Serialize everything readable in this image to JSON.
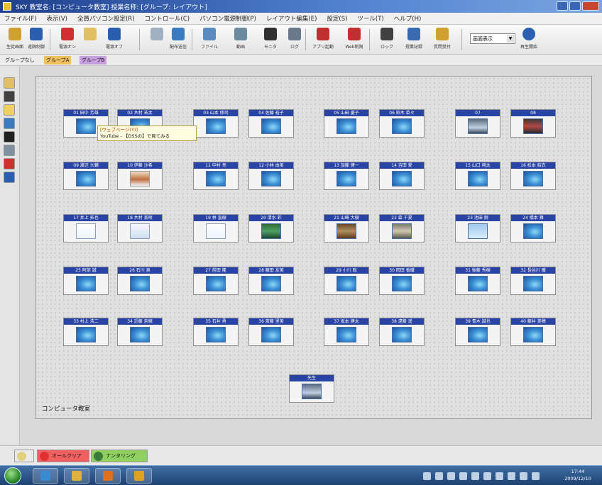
{
  "window": {
    "title": "SKY 教室名: [コンピュータ教室] 授業名称: [グループ: レイアウト]",
    "accent": "#2a44a6"
  },
  "menubar": [
    "ファイル(F)",
    "表示(V)",
    "全員パソコン設定(R)",
    "コントロール(C)",
    "パソコン電源制御(P)",
    "レイアウト編集(E)",
    "設定(S)",
    "ツール(T)",
    "ヘルプ(H)"
  ],
  "toolbar": {
    "buttons": [
      {
        "label": "生徒画面",
        "icon": "screen-share-icon",
        "color": "#d0a030"
      },
      {
        "label": "遠隔制御",
        "icon": "remote-icon",
        "color": "#2a5fb0"
      },
      {
        "label": "電源オン",
        "icon": "power-on-icon",
        "color": "#d03030"
      },
      {
        "label": "",
        "icon": "user-icon",
        "color": "#e0c060"
      },
      {
        "label": "電源オフ",
        "icon": "power-off-icon",
        "color": "#2a5fb0"
      },
      {
        "label": "",
        "icon": "message-icon",
        "color": "#a0b0c0"
      },
      {
        "label": "配布送信",
        "icon": "distribute-icon",
        "color": "#3a7ac0"
      },
      {
        "label": "ファイル",
        "icon": "file-icon",
        "color": "#5a8ac0"
      },
      {
        "label": "動画",
        "icon": "video-icon",
        "color": "#6a8aa0"
      },
      {
        "label": "モニタ",
        "icon": "monitor-icon",
        "color": "#303030"
      },
      {
        "label": "ログ",
        "icon": "log-icon",
        "color": "#6a7a8a"
      },
      {
        "label": "アプリ起動",
        "icon": "app-launch-icon",
        "color": "#c03030"
      },
      {
        "label": "Web制限",
        "icon": "web-block-icon",
        "color": "#c03030"
      },
      {
        "label": "ロック",
        "icon": "lock-icon",
        "color": "#404040"
      },
      {
        "label": "授業記録",
        "icon": "record-icon",
        "color": "#3a6ab0"
      },
      {
        "label": "質問受付",
        "icon": "question-icon",
        "color": "#d0a030"
      }
    ],
    "display_select": {
      "value": "画面表示",
      "arrow": "▼"
    },
    "play_button": {
      "label": "再生開始",
      "icon": "play-icon",
      "color": "#2a5fb0"
    }
  },
  "group_tabs": [
    {
      "label": "グループなし",
      "bg": "#ececec"
    },
    {
      "label": "グループA",
      "bg": "#f0c060"
    },
    {
      "label": "グループB",
      "bg": "#c8a0e0"
    }
  ],
  "left_dock": [
    {
      "icon": "student-icon",
      "color": "#e0c060"
    },
    {
      "icon": "grid-icon",
      "color": "#404040"
    },
    {
      "icon": "mail-icon",
      "color": "#f0d060"
    },
    {
      "icon": "share-icon",
      "color": "#3a7ac0"
    },
    {
      "icon": "monitor-black-icon",
      "color": "#202020"
    },
    {
      "icon": "layout-icon",
      "color": "#8090a0"
    },
    {
      "icon": "power-icon",
      "color": "#d03030"
    },
    {
      "icon": "power-blue-icon",
      "color": "#2a5fb0"
    }
  ],
  "classroom": {
    "label": "コンピュータ教室",
    "pcs": [
      {
        "name": "01 田中 芳雄",
        "screen": "win"
      },
      {
        "name": "02 木村 祐太",
        "screen": "win"
      },
      {
        "name": "03 山本 修司",
        "screen": "win"
      },
      {
        "name": "04 佐藤 裕子",
        "screen": "win"
      },
      {
        "name": "05 山田 慶子",
        "screen": "win"
      },
      {
        "name": "06 鈴木 菜々",
        "screen": "win"
      },
      {
        "name": "07",
        "screen": "tv"
      },
      {
        "name": "08",
        "screen": "red"
      },
      {
        "name": "09 渡辺 大輔",
        "screen": "win"
      },
      {
        "name": "10 伊藤 沙希",
        "screen": "video"
      },
      {
        "name": "11 中村 亮",
        "screen": "win"
      },
      {
        "name": "12 小林 由美",
        "screen": "win"
      },
      {
        "name": "13 加藤 健一",
        "screen": "win"
      },
      {
        "name": "14 吉田 愛",
        "screen": "win"
      },
      {
        "name": "15 山口 翔太",
        "screen": "win"
      },
      {
        "name": "16 松本 結衣",
        "screen": "win"
      },
      {
        "name": "17 井上 拓也",
        "screen": "doc"
      },
      {
        "name": "18 木村 美咲",
        "screen": "doc2"
      },
      {
        "name": "19 林 直樹",
        "screen": "doc"
      },
      {
        "name": "20 清水 彩",
        "screen": "green"
      },
      {
        "name": "21 山崎 大樹",
        "screen": "photo"
      },
      {
        "name": "22 森 千夏",
        "screen": "photo2"
      },
      {
        "name": "23 池田 剛",
        "screen": "blue2"
      },
      {
        "name": "24 橋本 舞",
        "screen": "win"
      },
      {
        "name": "25 阿部 誠",
        "screen": "win"
      },
      {
        "name": "26 石川 恵",
        "screen": "win"
      },
      {
        "name": "27 前田 隆",
        "screen": "win"
      },
      {
        "name": "28 藤田 友美",
        "screen": "win"
      },
      {
        "name": "29 小川 聡",
        "screen": "win"
      },
      {
        "name": "30 岡田 香織",
        "screen": "win"
      },
      {
        "name": "31 後藤 秀樹",
        "screen": "win"
      },
      {
        "name": "32 長谷川 瞳",
        "screen": "win"
      },
      {
        "name": "33 村上 浩二",
        "screen": "win"
      },
      {
        "name": "34 近藤 奈緒",
        "screen": "win"
      },
      {
        "name": "35 石井 勇",
        "screen": "win"
      },
      {
        "name": "36 斎藤 里美",
        "screen": "win"
      },
      {
        "name": "37 坂本 健太",
        "screen": "win"
      },
      {
        "name": "38 遠藤 遥",
        "screen": "win"
      },
      {
        "name": "39 青木 誠也",
        "screen": "win"
      },
      {
        "name": "40 藤井 美穂",
        "screen": "win"
      },
      {
        "name": "先生",
        "screen": "tv"
      }
    ]
  },
  "tooltip": {
    "line1": "[ウェブページ(Y)]",
    "line2": "YouTube - 【DSSの】で見てみる"
  },
  "bottom_bar": [
    {
      "label": "",
      "icon": "pencil-icon",
      "color": "#e0d080",
      "bg": "#eaeaea"
    },
    {
      "label": "オールクリア",
      "icon": "clear-icon",
      "color": "#e03030",
      "bg": "#f06060"
    },
    {
      "label": "ナンタリング",
      "icon": "monitoring-icon",
      "color": "#3a7a3a",
      "bg": "#90d060"
    }
  ],
  "taskbar": {
    "apps": [
      {
        "icon": "ie-icon",
        "color": "#3a8ad0"
      },
      {
        "icon": "folder-icon",
        "color": "#e0b040"
      },
      {
        "icon": "media-player-icon",
        "color": "#e07020"
      },
      {
        "icon": "sky-app-icon",
        "color": "#e0a020"
      }
    ],
    "clock": {
      "time": "17:44",
      "date": "2009/12/10"
    }
  }
}
